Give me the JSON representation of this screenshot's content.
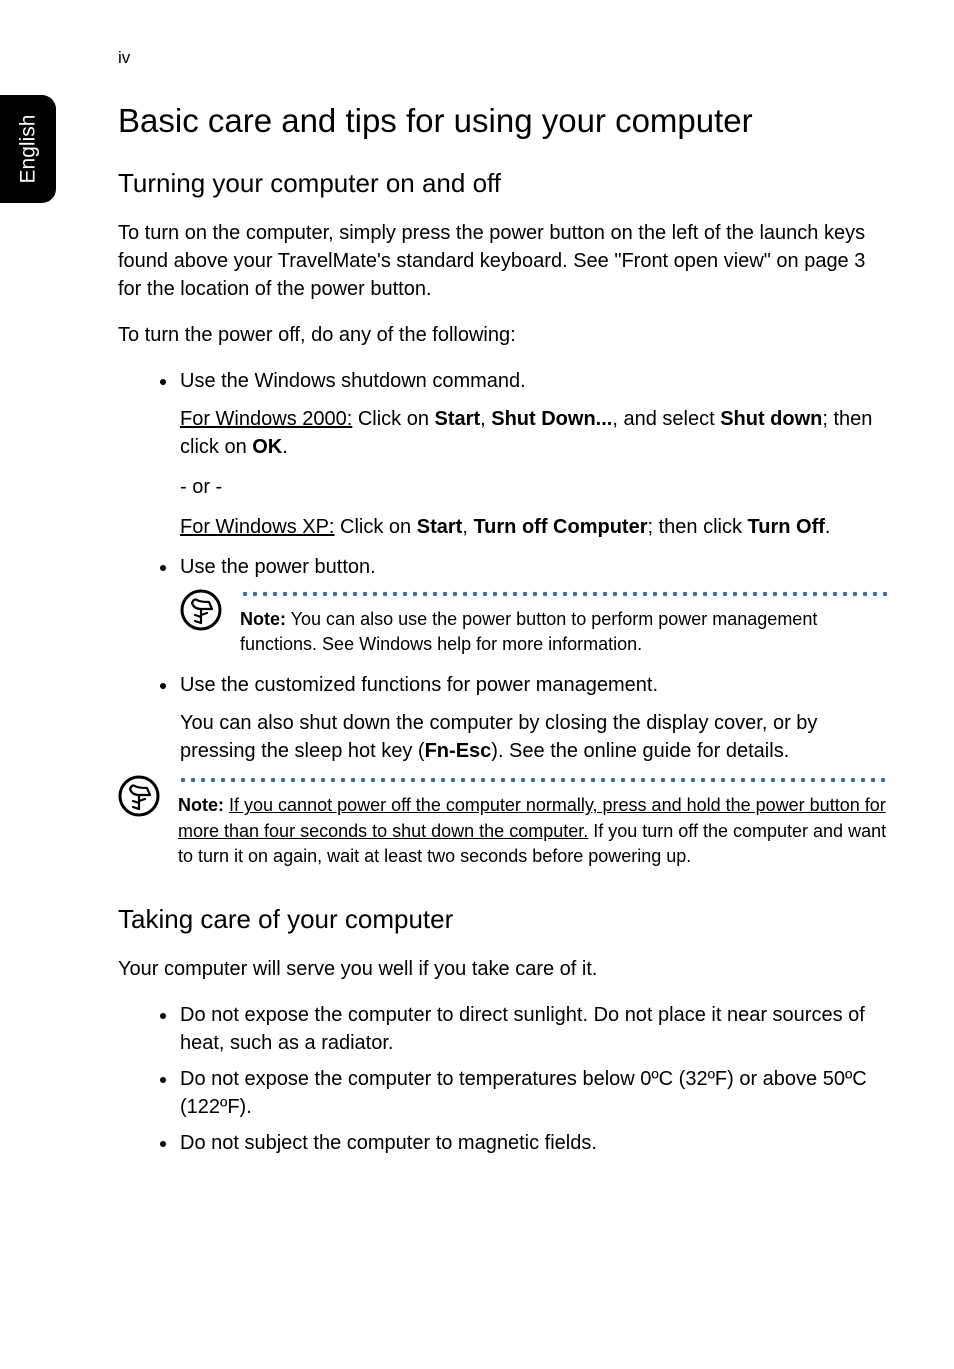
{
  "pageNumber": "iv",
  "sideTab": "English",
  "h1": "Basic care and tips for using your computer",
  "section1": {
    "heading": "Turning your computer on and off",
    "p1": "To turn on the computer, simply press the power button on the left of the launch keys found above your TravelMate's standard keyboard. See \"Front open view\" on page 3 for the location of the power button.",
    "p2": "To turn the power off, do any of the following:",
    "li1": {
      "text": "Use the Windows shutdown command.",
      "sub1_a": "For Windows 2000:",
      "sub1_b": " Click on ",
      "sub1_c": "Start",
      "sub1_d": ", ",
      "sub1_e": "Shut Down...",
      "sub1_f": ", and select ",
      "sub1_g": "Shut down",
      "sub1_h": "; then click on ",
      "sub1_i": "OK",
      "sub1_j": ".",
      "or": "- or -",
      "sub2_a": "For Windows XP:",
      "sub2_b": " Click on ",
      "sub2_c": "Start",
      "sub2_d": ", ",
      "sub2_e": "Turn off Computer",
      "sub2_f": "; then click ",
      "sub2_g": "Turn Off",
      "sub2_h": "."
    },
    "li2": "Use the power button.",
    "note1_a": "Note:",
    "note1_b": " You can also use the power button to perform power management functions. See Windows help for more information.",
    "li3": {
      "text": "Use the customized functions for power management.",
      "sub_a": "You can also shut down the computer by closing the display cover, or by pressing the sleep hot key (",
      "sub_b": "Fn-Esc",
      "sub_c": "). See the online guide for details."
    },
    "note2_a": "Note:",
    "note2_b": " ",
    "note2_c": "If you cannot power off the computer normally, press and hold the power button for more than four seconds to shut down the computer.",
    "note2_d": "  If you turn off the computer and want to turn it on again, wait at least two seconds before powering up."
  },
  "section2": {
    "heading": "Taking care of your computer",
    "p1": "Your computer will serve you well if you take care of it.",
    "li1": "Do not expose the computer to direct sunlight. Do not place it near sources of heat, such as a radiator.",
    "li2": "Do not expose the computer to temperatures below 0ºC (32ºF) or above 50ºC (122ºF).",
    "li3": "Do not subject the computer to magnetic fields."
  }
}
